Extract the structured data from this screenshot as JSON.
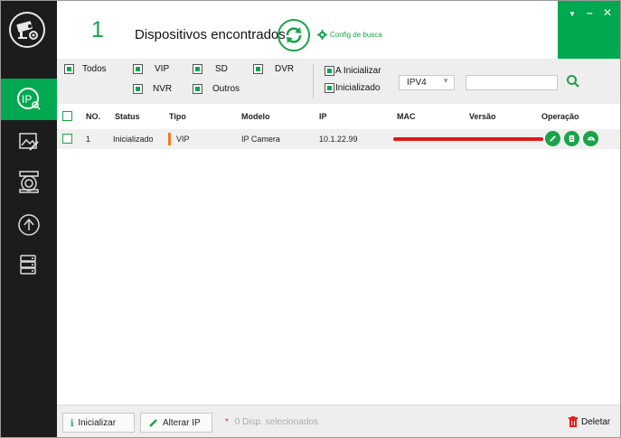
{
  "header": {
    "device_count": "1",
    "found_label": "Dispositivos encontrados",
    "config_label": "Config de busca"
  },
  "filters": {
    "row1": [
      {
        "label": "Todos",
        "checked": true
      },
      {
        "label": "VIP",
        "checked": true
      },
      {
        "label": "SD",
        "checked": true
      },
      {
        "label": "DVR",
        "checked": true
      }
    ],
    "row2": [
      {
        "label": "NVR",
        "checked": true
      },
      {
        "label": "Outros",
        "checked": true
      }
    ],
    "state": [
      {
        "label": "A Inicializar",
        "checked": true
      },
      {
        "label": "Inicializado",
        "checked": true
      }
    ],
    "ip_version": "IPV4",
    "search_value": ""
  },
  "table": {
    "columns": [
      "NO.",
      "Status",
      "Tipo",
      "Modelo",
      "IP",
      "MAC",
      "Versão",
      "Operação"
    ],
    "rows": [
      {
        "no": "1",
        "status": "Inicializado",
        "tipo": "VIP",
        "modelo": "IP Camera",
        "ip": "10.1.22.99"
      }
    ]
  },
  "bottom": {
    "init_label": "Inicializar",
    "alter_ip_label": "Alterar IP",
    "selected_count": "0",
    "selected_label": "Disp. selecionados",
    "delete_label": "Deletar"
  },
  "colors": {
    "accent": "#00a84f",
    "sidebar": "#1c1c1c",
    "type_bar": "#f07a1e",
    "redaction": "#e01818"
  },
  "icons": {
    "sidebar": [
      "app-logo-icon",
      "ip-search-icon",
      "picture-edit-icon",
      "camera-settings-icon",
      "upgrade-icon",
      "device-stack-icon"
    ],
    "operations": [
      "edit-icon",
      "config-icon",
      "web-browser-icon"
    ]
  }
}
